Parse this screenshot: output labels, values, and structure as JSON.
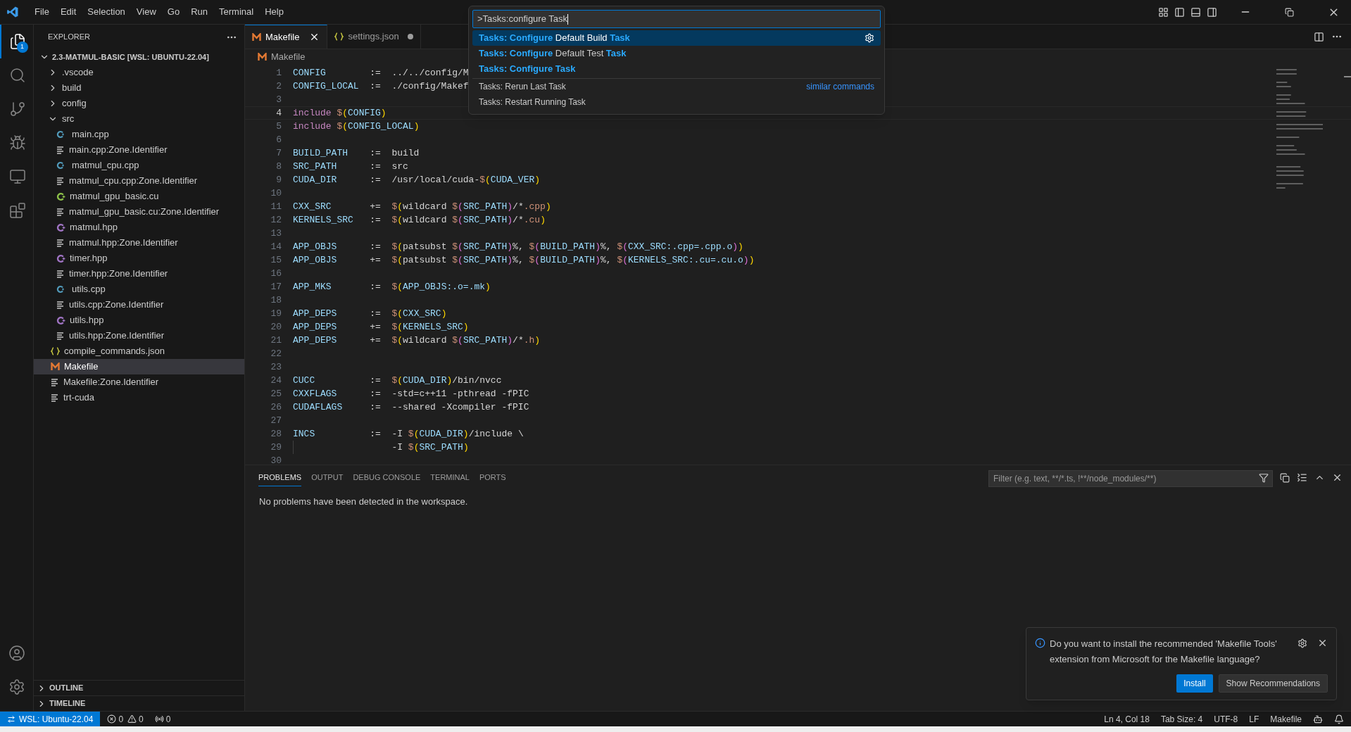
{
  "menu": [
    "File",
    "Edit",
    "Selection",
    "View",
    "Go",
    "Run",
    "Terminal",
    "Help"
  ],
  "activity_bar": {
    "items": [
      {
        "kind": "files",
        "selected": true,
        "badge": "1"
      },
      {
        "kind": "search",
        "selected": false
      },
      {
        "kind": "git",
        "selected": false
      },
      {
        "kind": "debug",
        "selected": false
      },
      {
        "kind": "remote",
        "selected": false
      },
      {
        "kind": "extensions",
        "selected": false
      }
    ],
    "bottom": [
      {
        "kind": "account"
      },
      {
        "kind": "settings"
      }
    ]
  },
  "sidebar": {
    "title": "EXPLORER",
    "root": {
      "label": "2.3-MATMUL-BASIC [WSL: UBUNTU-22.04]",
      "expanded": true
    },
    "items": [
      {
        "label": ".vscode",
        "kind": "folder",
        "expanded": false,
        "selected": false
      },
      {
        "label": "build",
        "kind": "folder",
        "expanded": false,
        "selected": false
      },
      {
        "label": "config",
        "kind": "folder",
        "expanded": false,
        "selected": false
      },
      {
        "label": "src",
        "kind": "folder",
        "expanded": true,
        "selected": false,
        "children": [
          {
            "label": "main.cpp",
            "kind": "cpp",
            "selected": false
          },
          {
            "label": "main.cpp:Zone.Identifier",
            "kind": "text",
            "selected": false
          },
          {
            "label": "matmul_cpu.cpp",
            "kind": "cpp",
            "selected": false
          },
          {
            "label": "matmul_cpu.cpp:Zone.Identifier",
            "kind": "text",
            "selected": false
          },
          {
            "label": "matmul_gpu_basic.cu",
            "kind": "cu",
            "selected": false
          },
          {
            "label": "matmul_gpu_basic.cu:Zone.Identifier",
            "kind": "text",
            "selected": false
          },
          {
            "label": "matmul.hpp",
            "kind": "hpp",
            "selected": false
          },
          {
            "label": "matmul.hpp:Zone.Identifier",
            "kind": "text",
            "selected": false
          },
          {
            "label": "timer.hpp",
            "kind": "hpp",
            "selected": false
          },
          {
            "label": "timer.hpp:Zone.Identifier",
            "kind": "text",
            "selected": false
          },
          {
            "label": "utils.cpp",
            "kind": "cpp",
            "selected": false
          },
          {
            "label": "utils.cpp:Zone.Identifier",
            "kind": "text",
            "selected": false
          },
          {
            "label": "utils.hpp",
            "kind": "hpp",
            "selected": false
          },
          {
            "label": "utils.hpp:Zone.Identifier",
            "kind": "text",
            "selected": false
          }
        ]
      },
      {
        "label": "compile_commands.json",
        "kind": "json",
        "selected": false
      },
      {
        "label": "Makefile",
        "kind": "make",
        "selected": true
      },
      {
        "label": "Makefile:Zone.Identifier",
        "kind": "text",
        "selected": false
      },
      {
        "label": "trt-cuda",
        "kind": "text",
        "selected": false
      }
    ],
    "sections": [
      {
        "label": "OUTLINE",
        "expanded": false
      },
      {
        "label": "TIMELINE",
        "expanded": false
      }
    ]
  },
  "tabs": [
    {
      "label": "Makefile",
      "kind": "make",
      "selected": true,
      "modified": false
    },
    {
      "label": "settings.json",
      "kind": "json",
      "selected": false,
      "modified": true
    }
  ],
  "breadcrumb": {
    "label": "Makefile",
    "kind": "make"
  },
  "code": [
    {
      "n": "1",
      "current": false,
      "name": "CONFIG",
      "op": ":=",
      "v": [
        {
          "text": "../../config/M",
          "kind": "plain"
        }
      ]
    },
    {
      "n": "2",
      "current": false,
      "name": "CONFIG_LOCAL",
      "op": ":=",
      "v": [
        {
          "text": "./config/Makef",
          "kind": "plain"
        }
      ]
    },
    {
      "n": "3",
      "current": false
    },
    {
      "n": "4",
      "current": true,
      "v": [
        {
          "text": "include ",
          "kind": "keyword"
        },
        {
          "text": "$",
          "kind": "dollar"
        },
        {
          "text": "(",
          "kind": "paren"
        },
        {
          "text": "CONFIG",
          "kind": "variable"
        },
        {
          "text": ")",
          "kind": "paren"
        }
      ]
    },
    {
      "n": "5",
      "current": false,
      "v": [
        {
          "text": "include ",
          "kind": "keyword"
        },
        {
          "text": "$",
          "kind": "dollar"
        },
        {
          "text": "(",
          "kind": "paren"
        },
        {
          "text": "CONFIG_LOCAL",
          "kind": "variable"
        },
        {
          "text": ")",
          "kind": "paren"
        }
      ]
    },
    {
      "n": "6",
      "current": false
    },
    {
      "n": "7",
      "current": false,
      "name": "BUILD_PATH",
      "op": ":=",
      "v": [
        {
          "text": "build",
          "kind": "plain"
        }
      ]
    },
    {
      "n": "8",
      "current": false,
      "name": "SRC_PATH",
      "op": ":=",
      "v": [
        {
          "text": "src",
          "kind": "plain"
        }
      ]
    },
    {
      "n": "9",
      "current": false,
      "name": "CUDA_DIR",
      "op": ":=",
      "v": [
        {
          "text": "/usr/local/cuda-",
          "kind": "plain"
        },
        {
          "text": "$",
          "kind": "dollar"
        },
        {
          "text": "(",
          "kind": "paren"
        },
        {
          "text": "CUDA_VER",
          "kind": "variable"
        },
        {
          "text": ")",
          "kind": "paren"
        }
      ]
    },
    {
      "n": "10",
      "current": false
    },
    {
      "n": "11",
      "current": false,
      "name": "CXX_SRC",
      "op": "+=",
      "v": [
        {
          "text": "$",
          "kind": "dollar"
        },
        {
          "text": "(",
          "kind": "paren"
        },
        {
          "text": "wildcard ",
          "kind": "plain"
        },
        {
          "text": "$",
          "kind": "dollar"
        },
        {
          "text": "(",
          "kind": "paren2"
        },
        {
          "text": "SRC_PATH",
          "kind": "variable"
        },
        {
          "text": ")",
          "kind": "paren2"
        },
        {
          "text": "/*",
          "kind": "plain"
        },
        {
          "text": ".cpp",
          "kind": "string"
        },
        {
          "text": ")",
          "kind": "paren"
        }
      ]
    },
    {
      "n": "12",
      "current": false,
      "name": "KERNELS_SRC",
      "op": ":=",
      "v": [
        {
          "text": "$",
          "kind": "dollar"
        },
        {
          "text": "(",
          "kind": "paren"
        },
        {
          "text": "wildcard ",
          "kind": "plain"
        },
        {
          "text": "$",
          "kind": "dollar"
        },
        {
          "text": "(",
          "kind": "paren2"
        },
        {
          "text": "SRC_PATH",
          "kind": "variable"
        },
        {
          "text": ")",
          "kind": "paren2"
        },
        {
          "text": "/*",
          "kind": "plain"
        },
        {
          "text": ".cu",
          "kind": "string"
        },
        {
          "text": ")",
          "kind": "paren"
        }
      ]
    },
    {
      "n": "13",
      "current": false
    },
    {
      "n": "14",
      "current": false,
      "name": "APP_OBJS",
      "op": ":=",
      "v": [
        {
          "text": "$",
          "kind": "dollar"
        },
        {
          "text": "(",
          "kind": "paren"
        },
        {
          "text": "patsubst ",
          "kind": "plain"
        },
        {
          "text": "$",
          "kind": "dollar"
        },
        {
          "text": "(",
          "kind": "paren2"
        },
        {
          "text": "SRC_PATH",
          "kind": "variable"
        },
        {
          "text": ")",
          "kind": "paren2"
        },
        {
          "text": "%, ",
          "kind": "plain"
        },
        {
          "text": "$",
          "kind": "dollar"
        },
        {
          "text": "(",
          "kind": "paren2"
        },
        {
          "text": "BUILD_PATH",
          "kind": "variable"
        },
        {
          "text": ")",
          "kind": "paren2"
        },
        {
          "text": "%, ",
          "kind": "plain"
        },
        {
          "text": "$",
          "kind": "dollar"
        },
        {
          "text": "(",
          "kind": "paren2"
        },
        {
          "text": "CXX_SRC:.cpp=.cpp.o",
          "kind": "variable"
        },
        {
          "text": ")",
          "kind": "paren2"
        },
        {
          "text": ")",
          "kind": "paren"
        }
      ]
    },
    {
      "n": "15",
      "current": false,
      "name": "APP_OBJS",
      "op": "+=",
      "v": [
        {
          "text": "$",
          "kind": "dollar"
        },
        {
          "text": "(",
          "kind": "paren"
        },
        {
          "text": "patsubst ",
          "kind": "plain"
        },
        {
          "text": "$",
          "kind": "dollar"
        },
        {
          "text": "(",
          "kind": "paren2"
        },
        {
          "text": "SRC_PATH",
          "kind": "variable"
        },
        {
          "text": ")",
          "kind": "paren2"
        },
        {
          "text": "%, ",
          "kind": "plain"
        },
        {
          "text": "$",
          "kind": "dollar"
        },
        {
          "text": "(",
          "kind": "paren2"
        },
        {
          "text": "BUILD_PATH",
          "kind": "variable"
        },
        {
          "text": ")",
          "kind": "paren2"
        },
        {
          "text": "%, ",
          "kind": "plain"
        },
        {
          "text": "$",
          "kind": "dollar"
        },
        {
          "text": "(",
          "kind": "paren2"
        },
        {
          "text": "KERNELS_SRC:.cu=.cu.o",
          "kind": "variable"
        },
        {
          "text": ")",
          "kind": "paren2"
        },
        {
          "text": ")",
          "kind": "paren"
        }
      ]
    },
    {
      "n": "16",
      "current": false
    },
    {
      "n": "17",
      "current": false,
      "name": "APP_MKS",
      "op": ":=",
      "v": [
        {
          "text": "$",
          "kind": "dollar"
        },
        {
          "text": "(",
          "kind": "paren"
        },
        {
          "text": "APP_OBJS:.o=.mk",
          "kind": "variable"
        },
        {
          "text": ")",
          "kind": "paren"
        }
      ]
    },
    {
      "n": "18",
      "current": false
    },
    {
      "n": "19",
      "current": false,
      "name": "APP_DEPS",
      "op": ":=",
      "v": [
        {
          "text": "$",
          "kind": "dollar"
        },
        {
          "text": "(",
          "kind": "paren"
        },
        {
          "text": "CXX_SRC",
          "kind": "variable"
        },
        {
          "text": ")",
          "kind": "paren"
        }
      ]
    },
    {
      "n": "20",
      "current": false,
      "name": "APP_DEPS",
      "op": "+=",
      "v": [
        {
          "text": "$",
          "kind": "dollar"
        },
        {
          "text": "(",
          "kind": "paren"
        },
        {
          "text": "KERNELS_SRC",
          "kind": "variable"
        },
        {
          "text": ")",
          "kind": "paren"
        }
      ]
    },
    {
      "n": "21",
      "current": false,
      "name": "APP_DEPS",
      "op": "+=",
      "v": [
        {
          "text": "$",
          "kind": "dollar"
        },
        {
          "text": "(",
          "kind": "paren"
        },
        {
          "text": "wildcard ",
          "kind": "plain"
        },
        {
          "text": "$",
          "kind": "dollar"
        },
        {
          "text": "(",
          "kind": "paren2"
        },
        {
          "text": "SRC_PATH",
          "kind": "variable"
        },
        {
          "text": ")",
          "kind": "paren2"
        },
        {
          "text": "/*",
          "kind": "plain"
        },
        {
          "text": ".h",
          "kind": "string"
        },
        {
          "text": ")",
          "kind": "paren"
        }
      ]
    },
    {
      "n": "22",
      "current": false
    },
    {
      "n": "23",
      "current": false
    },
    {
      "n": "24",
      "current": false,
      "name": "CUCC",
      "op": ":=",
      "v": [
        {
          "text": "$",
          "kind": "dollar"
        },
        {
          "text": "(",
          "kind": "paren"
        },
        {
          "text": "CUDA_DIR",
          "kind": "variable"
        },
        {
          "text": ")",
          "kind": "paren"
        },
        {
          "text": "/bin/nvcc",
          "kind": "plain"
        }
      ]
    },
    {
      "n": "25",
      "current": false,
      "name": "CXXFLAGS",
      "op": ":=",
      "v": [
        {
          "text": "-std=c++11 -pthread -fPIC",
          "kind": "plain"
        }
      ]
    },
    {
      "n": "26",
      "current": false,
      "name": "CUDAFLAGS",
      "op": ":=",
      "v": [
        {
          "text": "--shared -Xcompiler -fPIC",
          "kind": "plain"
        }
      ]
    },
    {
      "n": "27",
      "current": false
    },
    {
      "n": "28",
      "current": false,
      "name": "INCS",
      "op": ":=",
      "v": [
        {
          "text": "-I ",
          "kind": "plain"
        },
        {
          "text": "$",
          "kind": "dollar"
        },
        {
          "text": "(",
          "kind": "paren"
        },
        {
          "text": "CUDA_DIR",
          "kind": "variable"
        },
        {
          "text": ")",
          "kind": "paren"
        },
        {
          "text": "/include \\",
          "kind": "plain"
        }
      ]
    },
    {
      "n": "29",
      "current": false,
      "v": [
        {
          "text": "-I ",
          "kind": "plain"
        },
        {
          "text": "$",
          "kind": "dollar"
        },
        {
          "text": "(",
          "kind": "paren"
        },
        {
          "text": "SRC_PATH",
          "kind": "variable"
        },
        {
          "text": ")",
          "kind": "paren"
        }
      ]
    },
    {
      "n": "30",
      "current": false
    }
  ],
  "command_palette": {
    "value": ">Tasks:configure Task",
    "matches": [
      {
        "label": "**Tasks: Configure** Default Build **Task**",
        "selected": true
      },
      {
        "label": "**Tasks: Configure** Default Test **Task**",
        "selected": false
      },
      {
        "label": "**Tasks: Configure Task**",
        "selected": false
      }
    ],
    "other": [
      {
        "label": "Tasks: Rerun Last Task",
        "selected": false,
        "link": "similar commands"
      },
      {
        "label": "Tasks: Restart Running Task",
        "selected": false
      }
    ]
  },
  "panel": {
    "tabs": [
      {
        "label": "PROBLEMS",
        "selected": true
      },
      {
        "label": "OUTPUT",
        "selected": false
      },
      {
        "label": "DEBUG CONSOLE",
        "selected": false
      },
      {
        "label": "TERMINAL",
        "selected": false
      },
      {
        "label": "PORTS",
        "selected": false
      }
    ],
    "filter": {
      "placeholder": "Filter (e.g. text, **/*.ts, !**/node_modules/**)"
    },
    "message": "No problems have been detected in the workspace."
  },
  "notification": {
    "text": "Do you want to install the recommended 'Makefile Tools' extension from Microsoft for the Makefile language?",
    "buttons": [
      {
        "label": "Install",
        "kind": "primary"
      },
      {
        "label": "Show Recommendations",
        "kind": "secondary"
      }
    ]
  },
  "status_bar": {
    "remote": "WSL: Ubuntu-22.04",
    "errors": "0",
    "warnings": "0",
    "ports": "0",
    "right": [
      "Ln 4, Col 18",
      "Tab Size: 4",
      "UTF-8",
      "LF",
      "Makefile"
    ]
  }
}
